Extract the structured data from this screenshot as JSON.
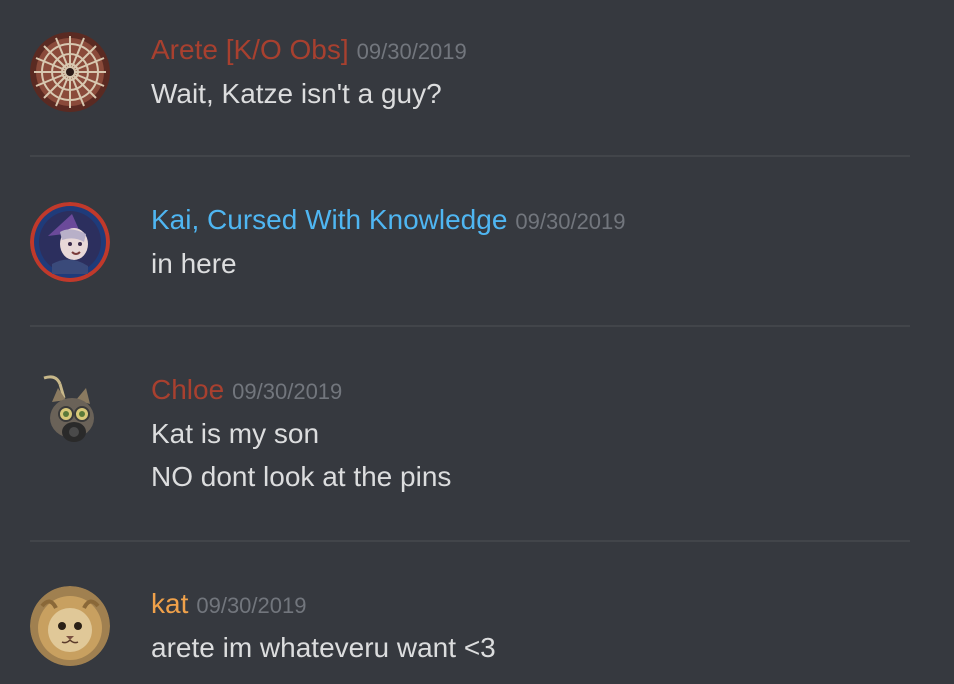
{
  "colors": {
    "background": "#36393f",
    "divider": "#42454a",
    "timestamp": "#72767d",
    "message_text": "#dcddde"
  },
  "messages": [
    {
      "author": "Arete [K/O Obs]",
      "author_color": "#a8402f",
      "timestamp": "09/30/2019",
      "avatar_icon": "mandala-avatar-icon",
      "lines": [
        "Wait, Katze isn't a guy?"
      ]
    },
    {
      "author": "Kai, Cursed With Knowledge",
      "author_color": "#4fb6f2",
      "timestamp": "09/30/2019",
      "avatar_icon": "witch-character-avatar-icon",
      "lines": [
        "in here"
      ]
    },
    {
      "author": "Chloe",
      "author_color": "#a8402f",
      "timestamp": "09/30/2019",
      "avatar_icon": "gasmask-cat-avatar-icon",
      "lines": [
        "Kat is my son",
        "NO dont look at the pins"
      ]
    },
    {
      "author": "kat",
      "author_color": "#f0a14a",
      "timestamp": "09/30/2019",
      "avatar_icon": "lion-cat-avatar-icon",
      "lines": [
        "arete im whateveru want <3"
      ]
    }
  ]
}
